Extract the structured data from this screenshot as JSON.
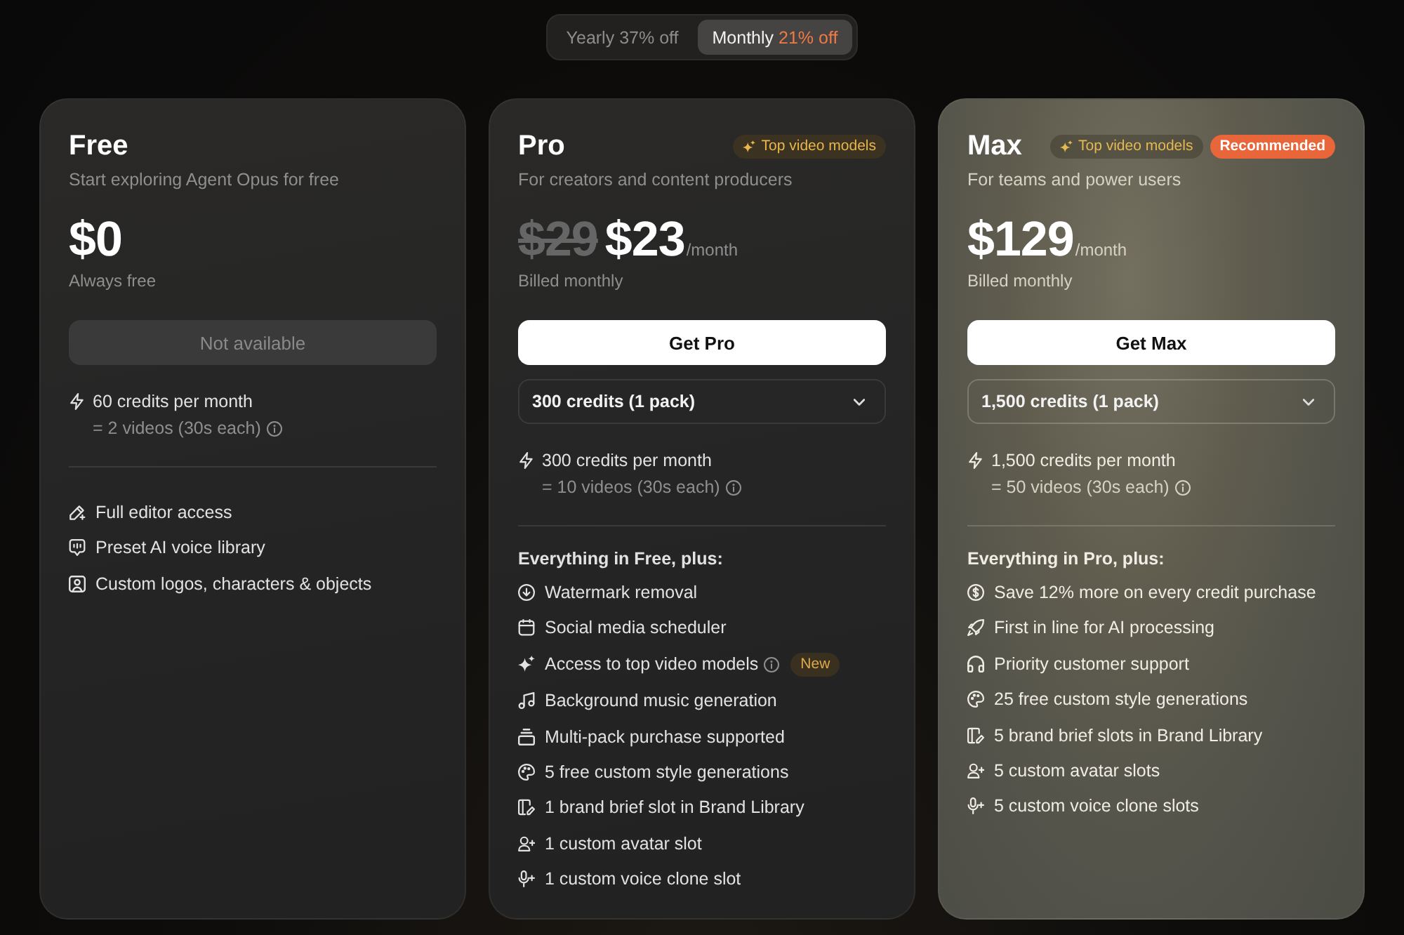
{
  "billing_toggle": [
    {
      "label": "Yearly",
      "discount": "37% off",
      "selected": false
    },
    {
      "label": "Monthly",
      "discount": "21% off",
      "selected": true
    }
  ],
  "plans": [
    {
      "name": "Free",
      "highlighted": false,
      "subtitle": "Start exploring Agent Opus for free",
      "price": "$0",
      "billing": "Always free",
      "button": {
        "label": "Not available",
        "disabled": true
      },
      "credits": {
        "label": "60 credits per month",
        "detail": "= 2 videos (30s each)"
      },
      "features": [
        {
          "kind": "editor",
          "label": "Full editor access",
          "info": false
        },
        {
          "kind": "voice",
          "label": "Preset AI voice library",
          "info": false
        },
        {
          "kind": "media",
          "label": "Custom logos, characters & objects",
          "info": false
        }
      ]
    },
    {
      "name": "Pro",
      "highlighted": false,
      "tags": [
        {
          "kind": "models",
          "label": "Top video models"
        }
      ],
      "subtitle": "For creators and content producers",
      "original_price": "$29",
      "price": "$23",
      "period": "/month",
      "billing": "Billed monthly",
      "button": {
        "label": "Get Pro",
        "disabled": false
      },
      "credit_pack": {
        "value": "300 credits (1 pack)"
      },
      "credits": {
        "label": "300 credits per month",
        "detail": "= 10 videos (30s each)"
      },
      "features_heading": "Everything in Free, plus:",
      "features": [
        {
          "kind": "watermark",
          "label": "Watermark removal",
          "info": false
        },
        {
          "kind": "scheduler",
          "label": "Social media scheduler",
          "info": false
        },
        {
          "kind": "models",
          "label": "Access to top video models",
          "info": true,
          "badge": "New"
        },
        {
          "kind": "music",
          "label": "Background music generation",
          "info": false
        },
        {
          "kind": "multipack",
          "label": "Multi-pack purchase supported",
          "info": false
        },
        {
          "kind": "style",
          "label": "5 free custom style generations",
          "info": false
        },
        {
          "kind": "brand",
          "label": "1 brand brief slot in Brand Library",
          "info": false
        },
        {
          "kind": "avatar",
          "label": "1 custom avatar slot",
          "info": false
        },
        {
          "kind": "voice-clone",
          "label": "1 custom voice clone slot",
          "info": false
        }
      ]
    },
    {
      "name": "Max",
      "highlighted": true,
      "tags": [
        {
          "kind": "models",
          "label": "Top video models"
        },
        {
          "kind": "recommended",
          "label": "Recommended"
        }
      ],
      "subtitle": "For teams and power users",
      "price": "$129",
      "period": "/month",
      "billing": "Billed monthly",
      "button": {
        "label": "Get Max",
        "disabled": false
      },
      "credit_pack": {
        "value": "1,500 credits (1 pack)"
      },
      "credits": {
        "label": "1,500 credits per month",
        "detail": "= 50 videos (30s each)"
      },
      "features_heading": "Everything in Pro, plus:",
      "features": [
        {
          "kind": "savings",
          "label": "Save 12% more on every credit purchase",
          "info": false
        },
        {
          "kind": "speed",
          "label": "First in line for AI processing",
          "info": false
        },
        {
          "kind": "support",
          "label": "Priority customer support",
          "info": false
        },
        {
          "kind": "style",
          "label": "25 free custom style generations",
          "info": false
        },
        {
          "kind": "brand",
          "label": "5 brand brief slots in Brand Library",
          "info": false
        },
        {
          "kind": "avatar",
          "label": "5 custom avatar slots",
          "info": false
        },
        {
          "kind": "voice-clone",
          "label": "5 custom voice clone slots",
          "info": false
        }
      ]
    }
  ]
}
